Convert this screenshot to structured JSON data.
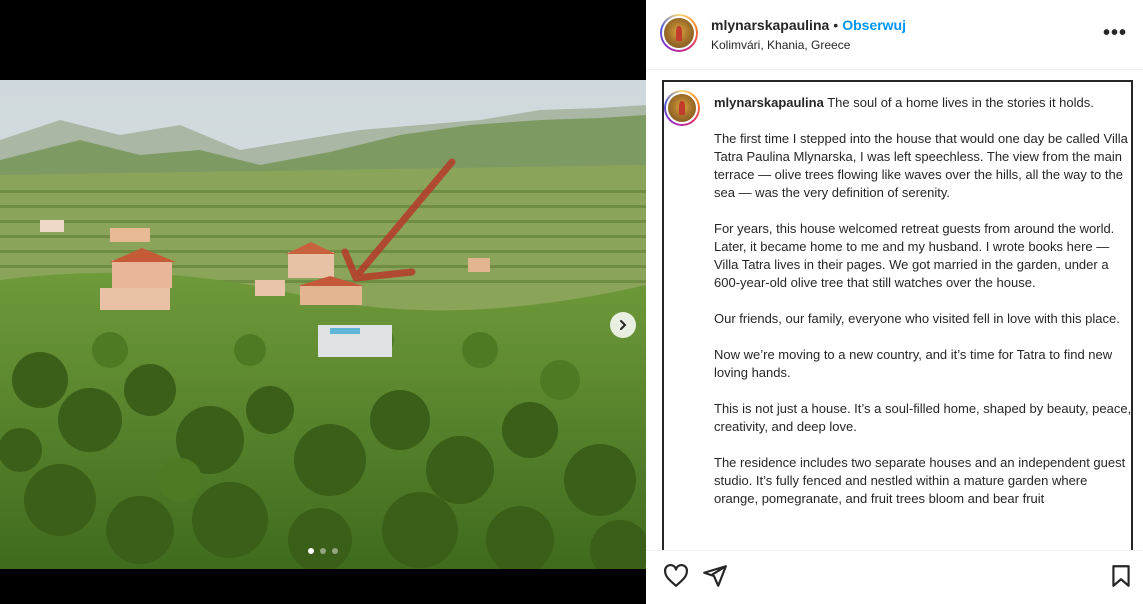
{
  "header": {
    "username": "mlynarskapaulina",
    "separator": "•",
    "follow_label": "Obserwuj",
    "location": "Kolimvári, Khania, Greece",
    "more_label": "•••"
  },
  "media": {
    "carousel_dots": 3,
    "active_dot": 0,
    "icons": {
      "next": "chevron-right-icon"
    }
  },
  "caption": {
    "username": "mlynarskapaulina",
    "first_line": "The soul of a home lives in the stories it holds.",
    "paragraphs": [
      "The first time I stepped into the house that would one day be called Villa Tatra Paulina Mlynarska, I was left speechless. The view from the main terrace — olive trees flowing like waves over the hills, all the way to the sea — was the very definition of serenity.",
      "For years, this house welcomed retreat guests from around the world. Later, it became home to me and my husband. I wrote books here — Villa Tatra lives in their pages. We got married in the garden, under a 600-year-old olive tree that still watches over the house.",
      "Our friends, our family, everyone who visited fell in love with this place.",
      "Now we’re moving to a new country, and it’s time for Tatra to find new loving hands.",
      "This is not just a house. It’s a soul-filled home, shaped by beauty, peace, creativity, and deep love.",
      "The residence includes two separate houses and an independent guest studio. It’s fully fenced and nestled within a mature garden where orange, pomegranate, and fruit trees bloom and bear fruit"
    ]
  },
  "actions": {
    "icons": [
      "heart-icon",
      "share-icon",
      "bookmark-icon"
    ]
  },
  "colors": {
    "accent": "#0095f6",
    "text": "#262626",
    "annotation_arrow": "#b53a2a"
  }
}
